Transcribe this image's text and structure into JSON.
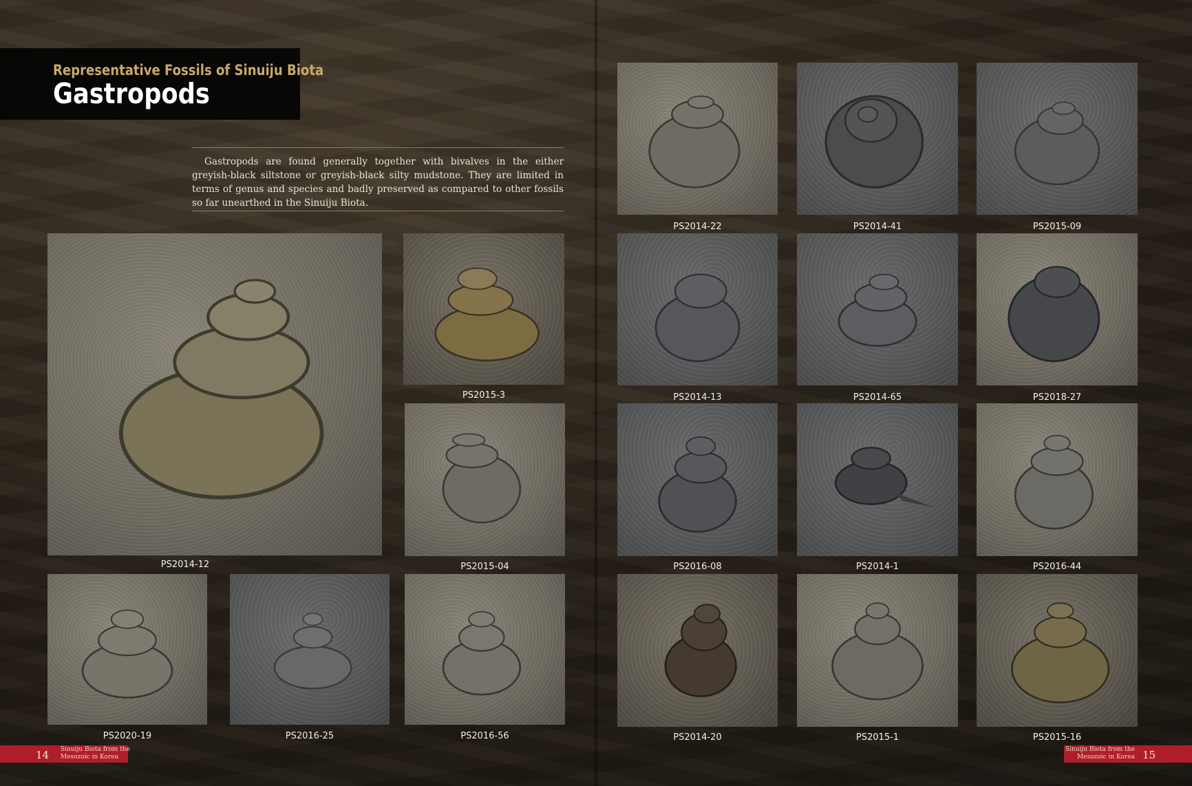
{
  "header": {
    "subtitle": "Representative Fossils of Sinuiju Biota",
    "title": "Gastropods"
  },
  "intro": "Gastropods are found generally together with bivalves in the either greyish-black siltstone or greyish-black silty mudstone. They are limited in terms of genus and species and badly preserved as compared to other fossils so far unearthed in the Sinuiju Biota.",
  "specimens": {
    "ps2014_12": "PS2014-12",
    "ps2015_3": "PS2015-3",
    "ps2015_04": "PS2015-04",
    "ps2020_19": "PS2020-19",
    "ps2016_25": "PS2016-25",
    "ps2016_56": "PS2016-56",
    "ps2014_22": "PS2014-22",
    "ps2014_41": "PS2014-41",
    "ps2015_09": "PS2015-09",
    "ps2014_13": "PS2014-13",
    "ps2014_65": "PS2014-65",
    "ps2018_27": "PS2018-27",
    "ps2016_08": "PS2016-08",
    "ps2014_1": "PS2014-1",
    "ps2016_44": "PS2016-44",
    "ps2014_20": "PS2014-20",
    "ps2015_1": "PS2015-1",
    "ps2015_16": "PS2015-16"
  },
  "footer": {
    "left_page": "14",
    "right_page": "15",
    "book_line1": "Sinuiju Biota from the",
    "book_line2": "Mesozoic in Korea",
    "accent_color": "#b01e2b"
  }
}
